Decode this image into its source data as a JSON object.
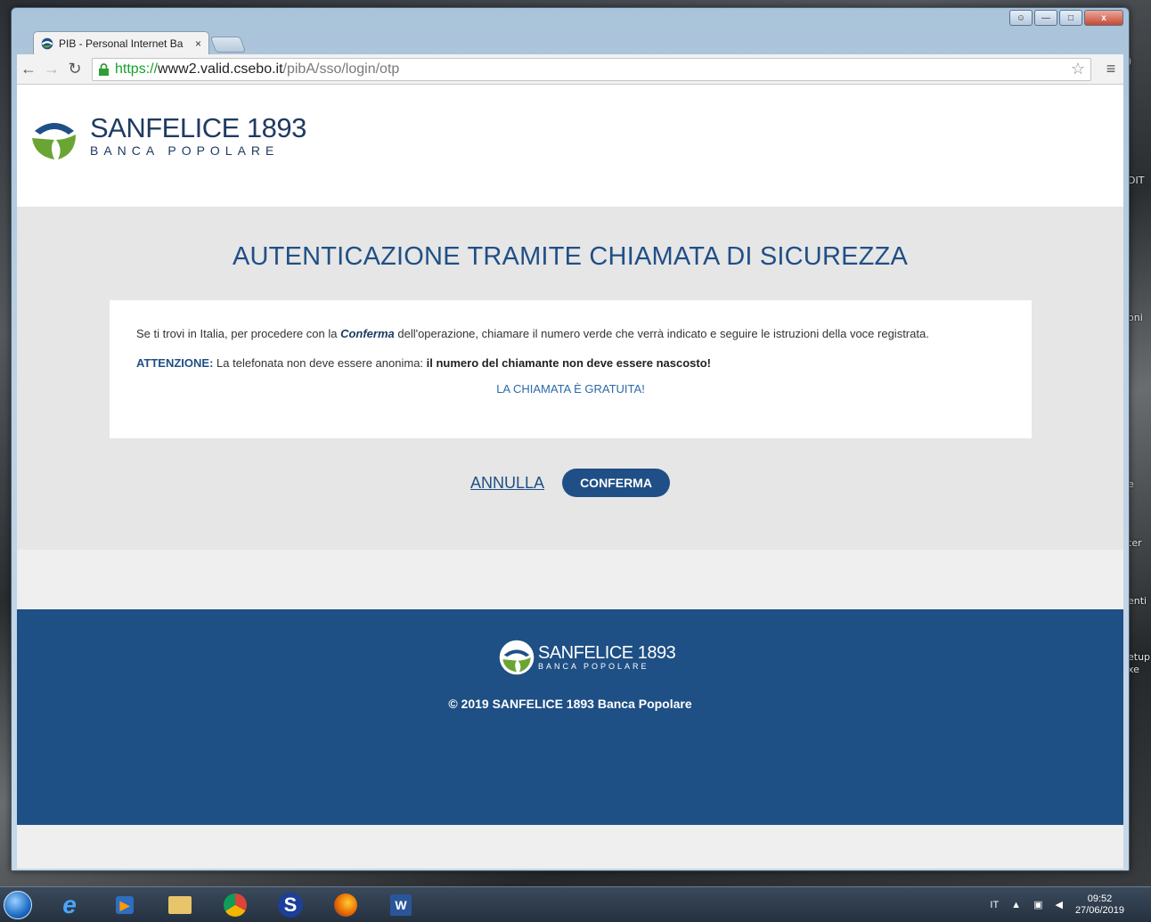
{
  "desktop": {
    "side_labels": [
      ")",
      "DIT",
      "oni",
      "e",
      "ter",
      "enti",
      "etup",
      "xe"
    ]
  },
  "browser": {
    "tab_title": "PIB - Personal Internet Ba",
    "tab_close": "×",
    "url_scheme": "https://",
    "url_host": "www2.valid.csebo.it",
    "url_path": "/pibA/sso/login/otp"
  },
  "brand": {
    "name": "SANFELICE",
    "year": "1893",
    "subtitle": "BANCA POPOLARE"
  },
  "page": {
    "title": "AUTENTICAZIONE TRAMITE CHIAMATA DI SICUREZZA",
    "line1_pre": "Se ti trovi in Italia, per procedere con la ",
    "line1_bold": "Conferma",
    "line1_post": " dell'operazione, chiamare il numero verde che verrà indicato e seguire le istruzioni della voce registrata.",
    "warning_label": "ATTENZIONE:",
    "warning_text": " La telefonata non deve essere anonima: ",
    "warning_strong": "il numero del chiamante non deve essere nascosto!",
    "free_call": "LA CHIAMATA È GRATUITA!",
    "cancel_label": "ANNULLA",
    "confirm_label": "CONFERMA"
  },
  "footer": {
    "copyright": "© 2019 SANFELICE 1893 Banca Popolare"
  },
  "taskbar": {
    "language": "IT",
    "time": "09:52",
    "date": "27/06/2019"
  },
  "colors": {
    "brand_blue": "#1f4f86",
    "brand_green": "#6aa533",
    "footer_bg": "#1e4f85"
  }
}
